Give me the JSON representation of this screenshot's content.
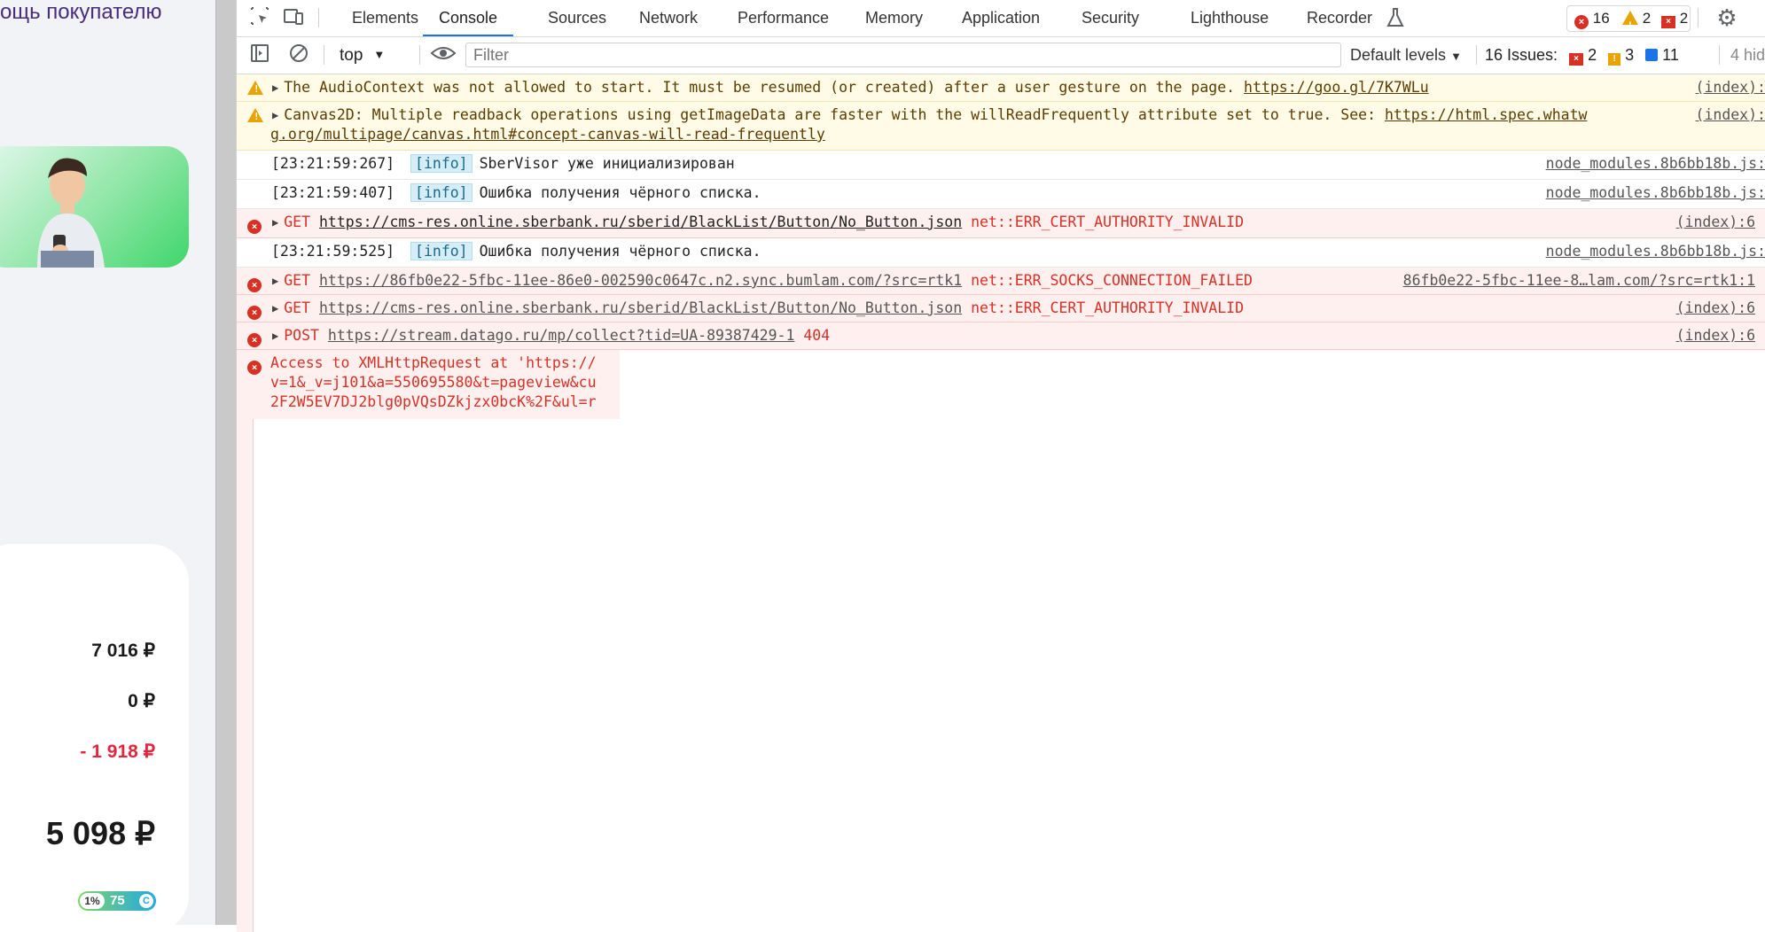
{
  "shop": {
    "title": "ощь покупателю",
    "prices": [
      "7 016 ₽",
      "0 ₽",
      "- 1 918 ₽",
      "5 098 ₽"
    ],
    "bonus": {
      "percent": "1%",
      "amount": "75",
      "coin": "C"
    }
  },
  "devtools": {
    "tabs": [
      "Elements",
      "Console",
      "Sources",
      "Network",
      "Performance",
      "Memory",
      "Application",
      "Security",
      "Lighthouse",
      "Recorder"
    ],
    "active_tab": "Console",
    "counts": {
      "errors": "16",
      "warnings": "2",
      "issues": "2"
    },
    "toolbar": {
      "context": "top",
      "filter_placeholder": "Filter",
      "levels": "Default levels",
      "issues_label": "16 Issues:",
      "issues_red": "2",
      "issues_orange": "3",
      "issues_blue": "11",
      "hidden": "4 hid"
    },
    "messages": [
      {
        "type": "warning",
        "text": "The AudioContext was not allowed to start. It must be resumed (or created) after a user gesture on the page.",
        "link": "https://goo.gl/7K7WLu",
        "source": "(index):"
      },
      {
        "type": "warning",
        "text": "Canvas2D: Multiple readback operations using getImageData are faster with the willReadFrequently attribute set to true. See:",
        "link": "https://html.spec.whatw",
        "link2": "g.org/multipage/canvas.html#concept-canvas-will-read-frequently",
        "source": "(index):"
      },
      {
        "type": "info",
        "time": "[23:21:59:267]",
        "badge": "[info]",
        "text": "SberVisor уже инициализирован",
        "source": "node_modules.8b6bb18b.js:"
      },
      {
        "type": "info",
        "time": "[23:21:59:407]",
        "badge": "[info]",
        "text": "Ошибка получения чёрного списка.",
        "source": "node_modules.8b6bb18b.js:"
      },
      {
        "type": "error",
        "method": "GET",
        "link": "https://cms-res.online.sberbank.ru/sberid/BlackList/Button/No_Button.json",
        "text": "net::ERR_CERT_AUTHORITY_INVALID",
        "source": "(index):6"
      },
      {
        "type": "info",
        "time": "[23:21:59:525]",
        "badge": "[info]",
        "text": "Ошибка получения чёрного списка.",
        "source": "node_modules.8b6bb18b.js:"
      },
      {
        "type": "error",
        "method": "GET",
        "link": "https://86fb0e22-5fbc-11ee-86e0-002590c0647c.n2.sync.bumlam.com/?src=rtk1",
        "text": "net::ERR_SOCKS_CONNECTION_FAILED",
        "source": "86fb0e22-5fbc-11ee-8…lam.com/?src=rtk1:1"
      },
      {
        "type": "error",
        "method": "GET",
        "link": "https://cms-res.online.sberbank.ru/sberid/BlackList/Button/No_Button.json",
        "text": "net::ERR_CERT_AUTHORITY_INVALID",
        "source": "(index):6"
      },
      {
        "type": "error",
        "method": "POST",
        "link": "https://stream.datago.ru/mp/collect?tid=UA-89387429-1",
        "text": "404",
        "source": "(index):6"
      },
      {
        "type": "error",
        "lines": [
          "Access to XMLHttpRequest at 'https://",
          "v=1&_v=j101&a=550695580&t=pageview&cu",
          "2F2W5EV7DJ2blg0pVQsDZkjzx0bcK%2F&ul=r"
        ]
      }
    ]
  },
  "colors": {
    "accent": "#1a73e8",
    "error": "#d93025",
    "warning": "#e8a400",
    "warning_bg": "#fffbe6",
    "error_bg": "#fff0f0",
    "info_badge_bg": "#d4edf6"
  },
  "icons": [
    "inspect-icon",
    "device-toggle-icon",
    "sidebar-icon",
    "clear-icon",
    "eye-icon",
    "flask-icon",
    "gear-icon",
    "warning-icon",
    "error-icon",
    "expand-triangle-icon"
  ]
}
